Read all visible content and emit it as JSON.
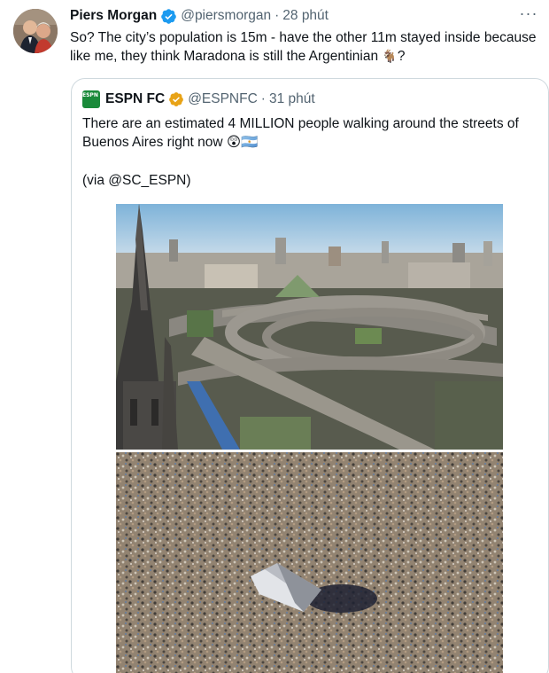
{
  "tweet": {
    "author_name": "Piers Morgan",
    "handle": "@piersmorgan",
    "separator": "·",
    "time": "28 phút",
    "more_label": "···",
    "text": "So? The city’s population is 15m - have the other 11m stayed inside because like me, they think Maradona is still the Argentinian ",
    "text_emoji": "🐐",
    "text_end": "?"
  },
  "quoted": {
    "author_name": "ESPN FC",
    "logo_text": "ESPN FC",
    "handle": "@ESPNFC",
    "separator": "·",
    "time": "31 phút",
    "text": "There are an estimated 4 MILLION people walking around the streets of Buenos Aires right now ",
    "text_emoji": "😲🇦🇷",
    "via": "(via @SC_ESPN)"
  },
  "icons": {
    "verified": "verified-badge-icon",
    "more": "more-dots-icon"
  },
  "colors": {
    "verified_blue": "#1d9bf0",
    "text_primary": "#0f1419",
    "text_secondary": "#536471",
    "border": "#cfd9de",
    "espn_green": "#1a8a3a"
  }
}
